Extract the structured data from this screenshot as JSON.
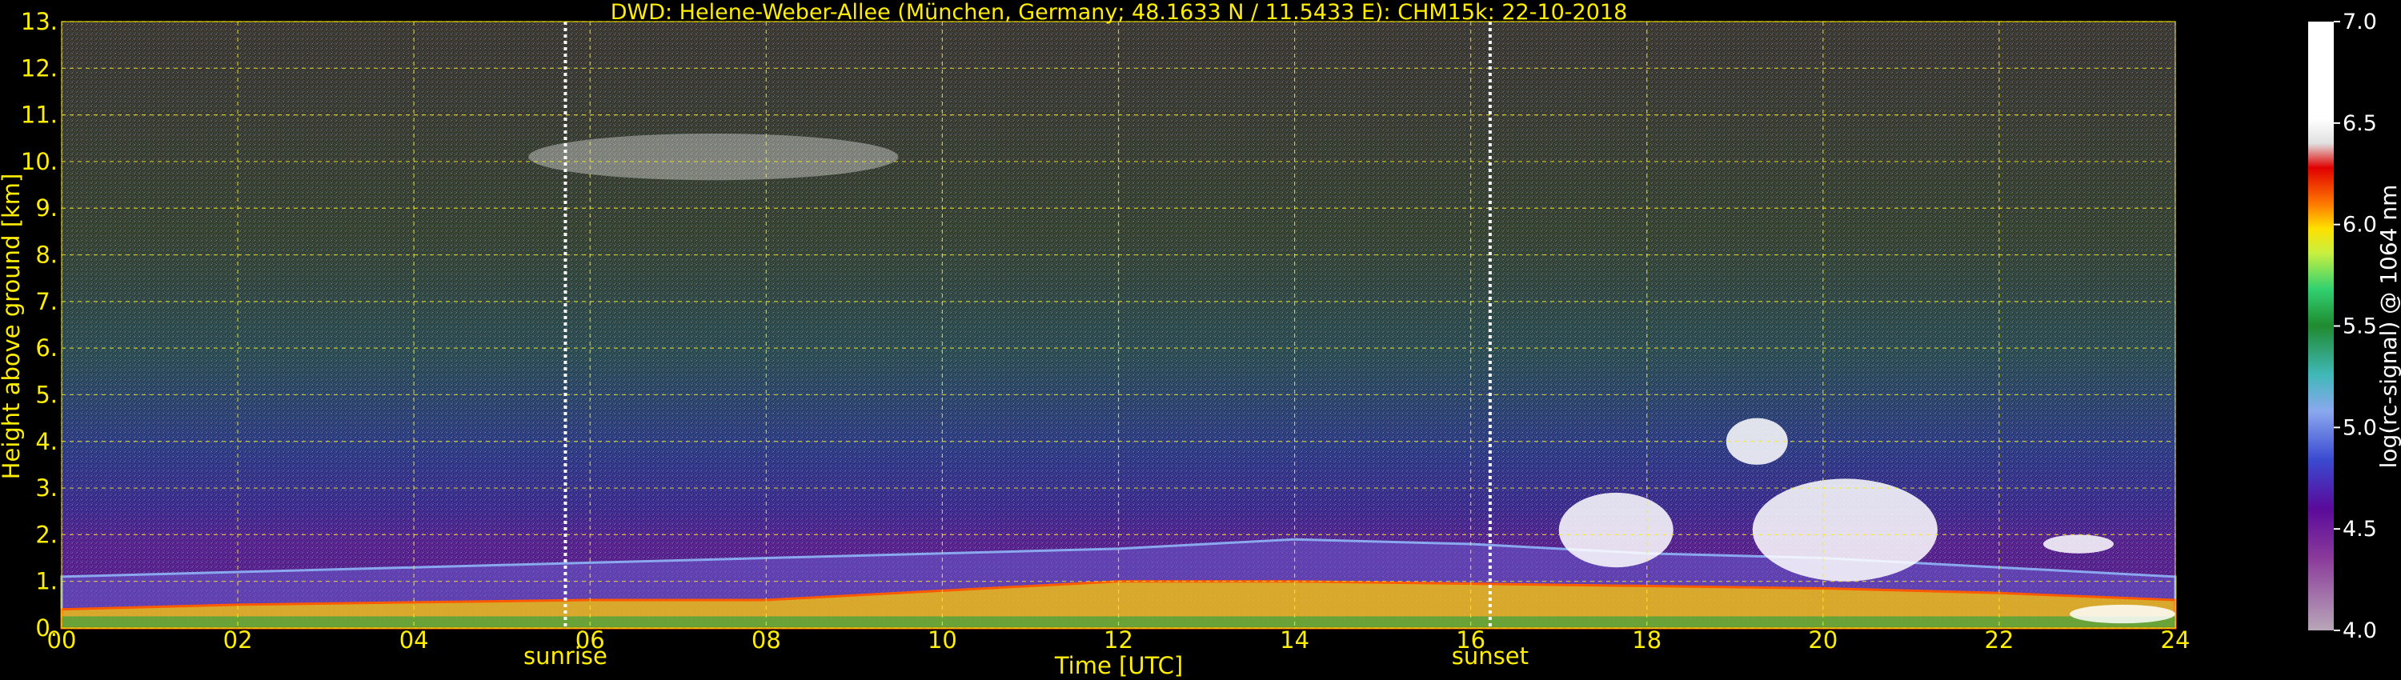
{
  "chart_data": {
    "type": "heatmap",
    "title": "DWD: Helene-Weber-Allee (München, Germany; 48.1633 N / 11.5433 E):    CHM15k: 22-10-2018",
    "xlabel": "Time [UTC]",
    "ylabel": "Height above ground [km]",
    "xlim": [
      0,
      24
    ],
    "ylim": [
      0,
      13
    ],
    "x_ticks": [
      "00",
      "02",
      "04",
      "06",
      "08",
      "10",
      "12",
      "14",
      "16",
      "18",
      "20",
      "22",
      "24"
    ],
    "y_ticks": [
      "0.",
      "1.",
      "2.",
      "3.",
      "4.",
      "5.",
      "6.",
      "7.",
      "8.",
      "9.",
      "10.",
      "11.",
      "12.",
      "13."
    ],
    "grid": true,
    "annotations": [
      {
        "label": "sunrise",
        "x": 5.72
      },
      {
        "label": "sunset",
        "x": 16.22
      }
    ],
    "colorbar": {
      "label": "log(rc-signal) @ 1064 nm",
      "range": [
        4.0,
        7.0
      ],
      "ticks": [
        "4.0",
        "4.5",
        "5.0",
        "5.5",
        "6.0",
        "6.5",
        "7.0"
      ],
      "placement": "right"
    },
    "cloud_features": [
      {
        "desc": "cirrus",
        "x_range": [
          5.3,
          9.5
        ],
        "y_range": [
          9.6,
          10.6
        ]
      },
      {
        "desc": "cloud",
        "x_range": [
          17.0,
          18.3
        ],
        "y_range": [
          1.3,
          2.9
        ]
      },
      {
        "desc": "cloud",
        "x_range": [
          18.9,
          19.6
        ],
        "y_range": [
          3.5,
          4.5
        ]
      },
      {
        "desc": "cloud",
        "x_range": [
          19.2,
          21.3
        ],
        "y_range": [
          1.0,
          3.2
        ]
      },
      {
        "desc": "cloud",
        "x_range": [
          22.5,
          23.3
        ],
        "y_range": [
          1.6,
          2.0
        ]
      },
      {
        "desc": "low cloud",
        "x_range": [
          22.8,
          24.0
        ],
        "y_range": [
          0.1,
          0.5
        ]
      }
    ],
    "layers": [
      {
        "name": "boundary layer top",
        "x": [
          0,
          2,
          4,
          6,
          8,
          10,
          12,
          14,
          16,
          18,
          20,
          22,
          24
        ],
        "y": [
          1.1,
          1.2,
          1.3,
          1.4,
          1.5,
          1.6,
          1.7,
          1.9,
          1.8,
          1.6,
          1.5,
          1.3,
          1.1
        ]
      },
      {
        "name": "aerosol layer top",
        "x": [
          0,
          2,
          4,
          6,
          8,
          10,
          12,
          14,
          16,
          18,
          20,
          22,
          24
        ],
        "y": [
          0.4,
          0.5,
          0.55,
          0.6,
          0.6,
          0.8,
          1.0,
          1.0,
          0.95,
          0.9,
          0.85,
          0.75,
          0.6
        ]
      }
    ]
  }
}
